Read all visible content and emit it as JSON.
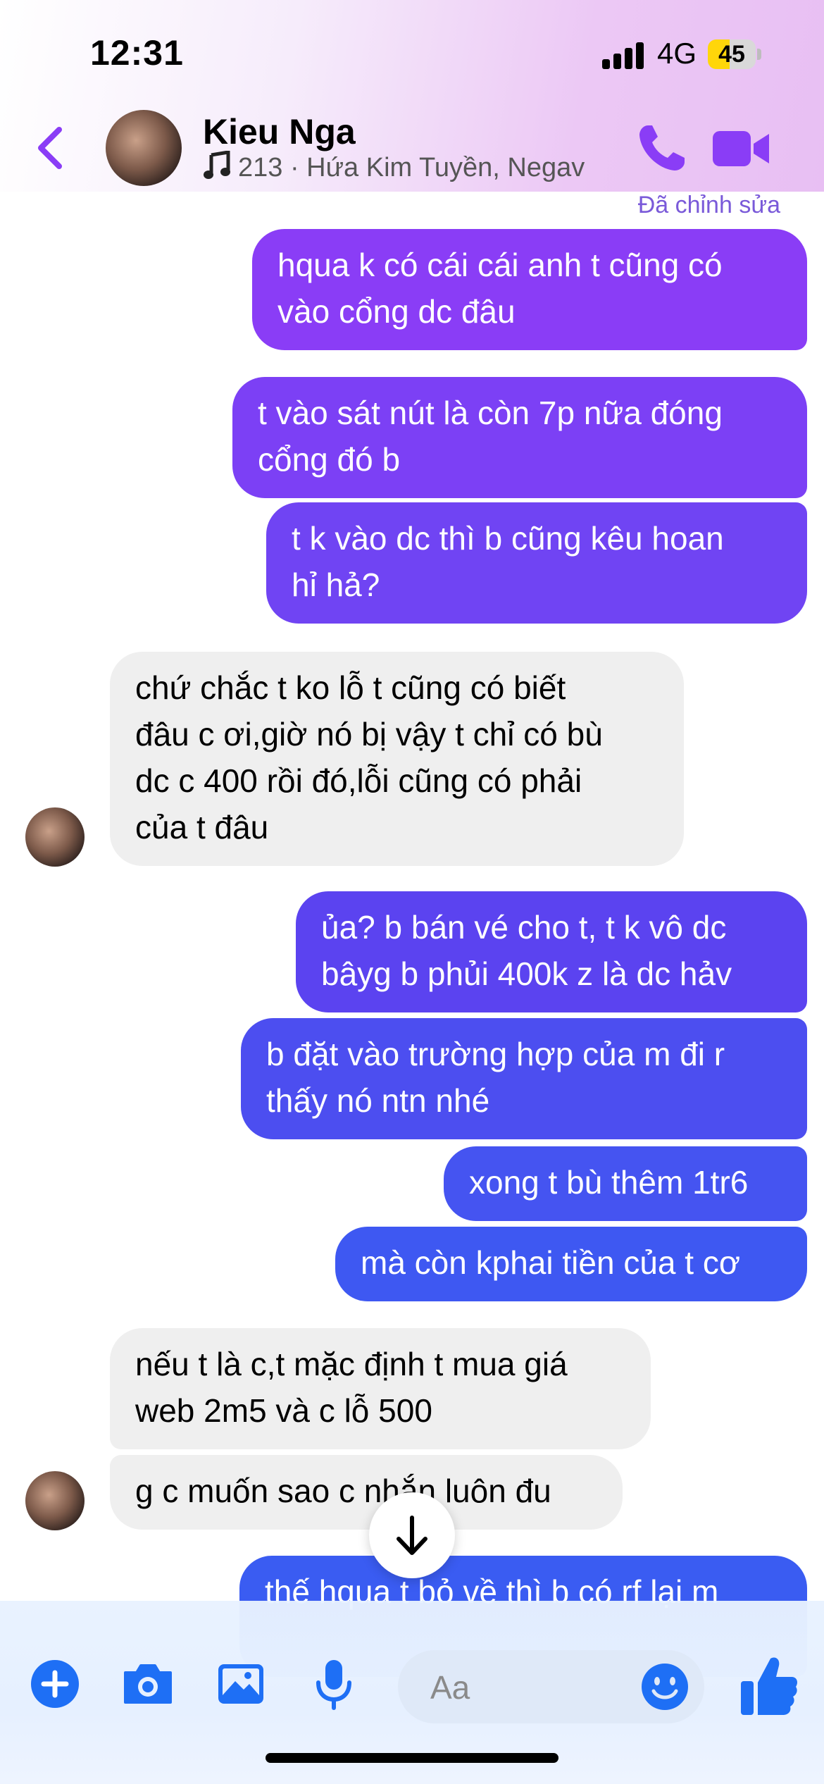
{
  "status": {
    "time": "12:31",
    "network": "4G",
    "battery": "45",
    "battery_level": 0.45
  },
  "header": {
    "name": "Kieu Nga",
    "subtitle": "213 · Hứa Kim Tuyền, Negav"
  },
  "messages": {
    "edited_label": "Đã chỉnh sửa",
    "m1": "hqua k có cái cái anh t cũng có\nvào cổng dc đâu",
    "m2": "t vào sát nút là còn 7p nữa đóng\ncổng đó b",
    "m3": "t k vào dc thì b cũng kêu hoan\nhỉ hả?",
    "m4": "chứ chắc t ko lỗ t cũng có biết\nđâu c ơi,giờ nó bị vậy t chỉ có bù\ndc c 400 rồi đó,lỗi cũng có phải\ncủa t đâu",
    "m5": "ủa? b bán vé cho t, t k vô dc\nbâyg b phủi 400k z là dc hảv",
    "m6": "b đặt vào trường hợp của m đi r\nthấy nó ntn nhé",
    "m7": "xong t bù thêm 1tr6",
    "m8": "mà còn kphai tiền của t cơ",
    "m9": "nếu t là c,t mặc định t mua giá\nweb 2m5 và c lỗ 500",
    "m10": "g c muốn sao c nhắn luôn đu",
    "m11": "thế hqua t bỏ về thì b có rf lại m"
  },
  "composer": {
    "placeholder": "Aa"
  },
  "colors": {
    "accent": "#7f3cf5",
    "bubble_purple": "#8a3df6",
    "bubble_indigo": "#5b43f0",
    "bubble_blue": "#3a5cf2",
    "bubble_incoming": "#efefef",
    "composer_icon": "#1e6ff5"
  }
}
